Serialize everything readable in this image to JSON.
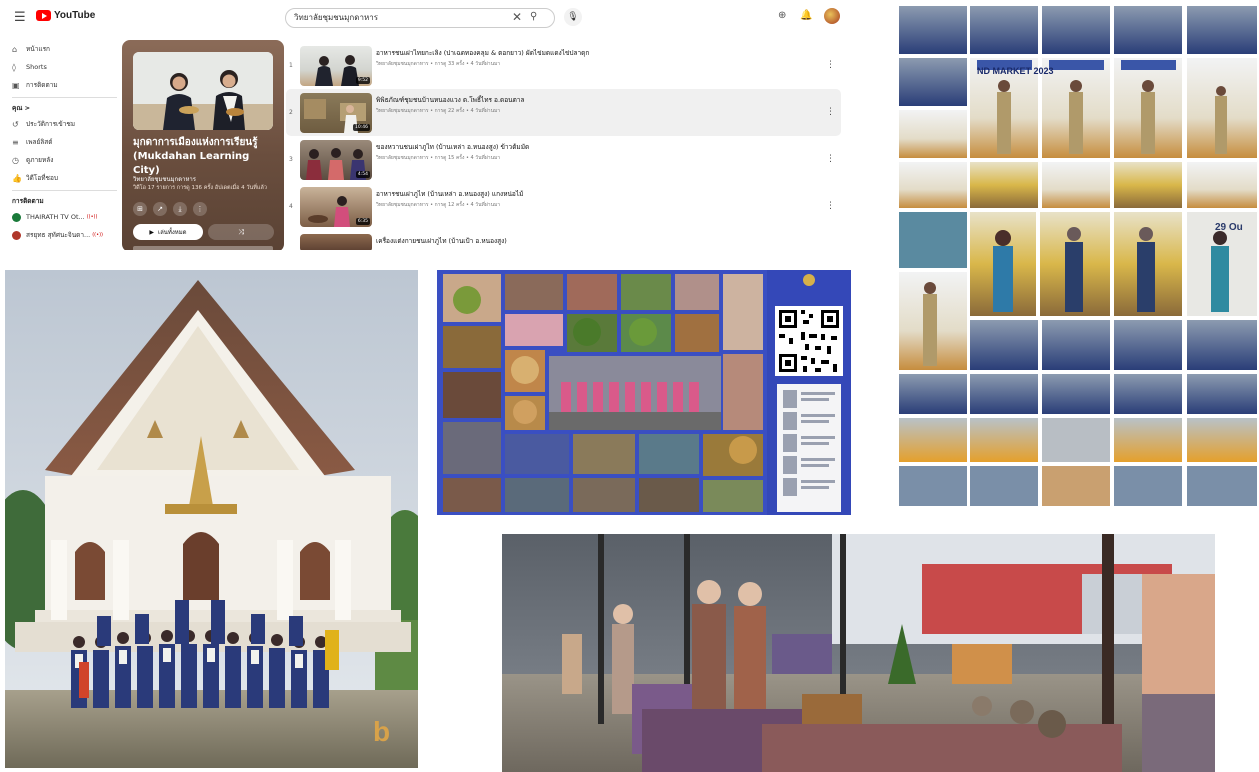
{
  "youtube": {
    "logo_text": "YouTube",
    "search_value": "วิทยาลัยชุมชนมุกดาหาร",
    "sidebar": {
      "items": [
        {
          "icon": "home-icon",
          "label": "หน้าแรก"
        },
        {
          "icon": "shorts-icon",
          "label": "Shorts"
        },
        {
          "icon": "subscriptions-icon",
          "label": "การติดตาม"
        }
      ],
      "you_header": "คุณ >",
      "you_items": [
        {
          "icon": "history-icon",
          "label": "ประวัติการเข้าชม"
        },
        {
          "icon": "playlist-icon",
          "label": "เพลย์ลิสต์"
        },
        {
          "icon": "watch-later-icon",
          "label": "ดูภายหลัง"
        },
        {
          "icon": "liked-icon",
          "label": "วิดีโอที่ชอบ"
        }
      ],
      "subs_header": "การติดตาม",
      "subs": [
        {
          "label": "THAIRATH TV Ot...",
          "color": "#1a7a3a"
        },
        {
          "label": "สรยุทธ สุทัศนะจินดา...",
          "color": "#b0372a"
        }
      ]
    },
    "playlist": {
      "title": "มุกดาการเมืองแห่งการเรียนรู้ (Mukdahan Learning City)",
      "channel": "วิทยาลัยชุมชนมุกดาหาร",
      "meta": "วิดีโอ 17 รายการ การดู 136 ครั้ง อัปเดตเมื่อ 4 วันที่แล้ว",
      "play_label": "เล่นทั้งหมด",
      "shuffle_label": "⤨"
    },
    "videos": [
      {
        "num": "1",
        "title": "อาหารชนเผ่าไทยกะเลิง (ปาเฉดทองคลุม & ตอกยาว) ผัดไข่มดแดงไข่ปลาดุก",
        "meta": "วิทยาลัยชุมชนมุกดาหาร • การดู 33 ครั้ง • 4 วันที่ผ่านมา",
        "dur": "9:52"
      },
      {
        "num": "2",
        "title": "พิพิธภัณฑ์ชุมชนบ้านหนองแวง ต.โพธิ์ไทร อ.ดอนตาล",
        "meta": "วิทยาลัยชุมชนมุกดาหาร • การดู 22 ครั้ง • 4 วันที่ผ่านมา",
        "dur": "10:46"
      },
      {
        "num": "3",
        "title": "ของหวานชนเผ่าภูไท (บ้านเหล่า อ.หนองสูง) ข้าวต้มมัด",
        "meta": "วิทยาลัยชุมชนมุกดาหาร • การดู 15 ครั้ง • 4 วันที่ผ่านมา",
        "dur": "4:54"
      },
      {
        "num": "4",
        "title": "อาหารชนเผ่าภูไท (บ้านเหล่า อ.หนองสูง) แกงหน่อไม้",
        "meta": "วิทยาลัยชุมชนมุกดาหาร • การดู 12 ครั้ง • 4 วันที่ผ่านมา",
        "dur": "6:35"
      },
      {
        "num": "5",
        "title": "เครื่องแต่งกายชนเผ่าภูไท (บ้านเป้า อ.หนองสูง)",
        "meta": "",
        "dur": ""
      }
    ]
  },
  "collage": {
    "qr_caption": "Mukdahan Learning City"
  },
  "grid": {
    "banner_text": "ND MARKET 2023",
    "date_text": "29 Ou"
  },
  "temple": {
    "watermark": "b"
  },
  "colors": {
    "youtube_red": "#ff0000",
    "playlist_brown": "#6a4e3e",
    "collage_blue": "#3a4fc2"
  }
}
